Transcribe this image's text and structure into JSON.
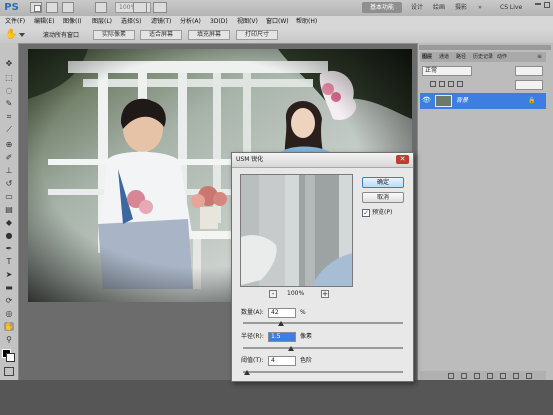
{
  "app": {
    "logo": "PS",
    "zoom": "100%",
    "workspaces": [
      "基本功能",
      "设计",
      "绘画",
      "摄影"
    ],
    "cs_live": "CS Live"
  },
  "menu": [
    "文件(F)",
    "编辑(E)",
    "图像(I)",
    "图层(L)",
    "选择(S)",
    "滤镜(T)",
    "分析(A)",
    "3D(D)",
    "视图(V)",
    "窗口(W)",
    "帮助(H)"
  ],
  "options": {
    "scroll_all_windows": "滚动所有窗口",
    "buttons": [
      "实际像素",
      "适合屏幕",
      "填充屏幕",
      "打印尺寸"
    ]
  },
  "layers_panel": {
    "tabs": [
      "图层",
      "通道",
      "路径",
      "历史记录",
      "动作"
    ],
    "blend_mode": "正常",
    "layer_name": "背景"
  },
  "dialog": {
    "title": "USM 锐化",
    "ok": "确定",
    "cancel": "取消",
    "preview_label": "预览(P)",
    "preview_checked": true,
    "zoom": "100%",
    "amount_label": "数量(A):",
    "amount_value": "42",
    "amount_unit": "%",
    "radius_label": "半径(R):",
    "radius_value": "1.5",
    "radius_unit": "像素",
    "threshold_label": "阈值(T):",
    "threshold_value": "4",
    "threshold_unit": "色阶"
  }
}
